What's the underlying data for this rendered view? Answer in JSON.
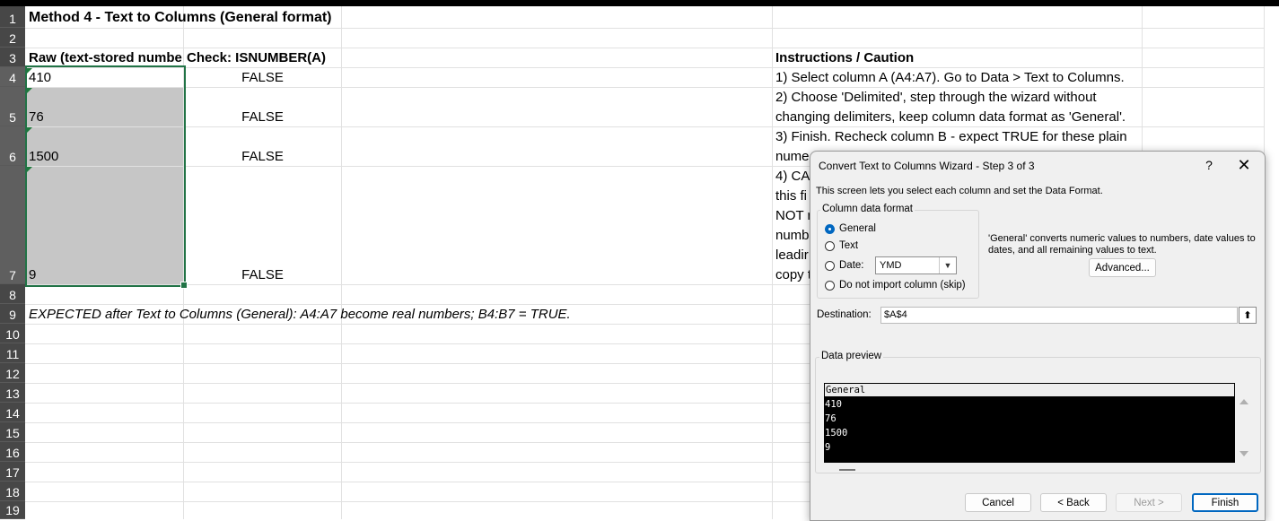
{
  "sheet": {
    "rows": [
      "1",
      "2",
      "3",
      "4",
      "5",
      "6",
      "7",
      "8",
      "9",
      "10",
      "11",
      "12",
      "13",
      "14",
      "15",
      "16",
      "17",
      "18",
      "19"
    ],
    "title": "Method 4 - Text to Columns (General format)",
    "header_a": "Raw (text-stored numbe",
    "header_b": "Check: ISNUMBER(A)",
    "header_instr": "Instructions / Caution",
    "a_values": [
      "410",
      "76",
      "1500",
      "9"
    ],
    "b_values": [
      "FALSE",
      "FALSE",
      "FALSE",
      "FALSE"
    ],
    "instr_1": "1) Select column A (A4:A7). Go to Data > Text to Columns.",
    "instr_2": "2) Choose 'Delimited', step through the wizard without changing delimiters, keep column data format as 'General'.",
    "instr_3": "3) Finish. Recheck column B - expect TRUE for these plain nume",
    "instr_4": "4) CA\nthis fi\nNOT r\nnumb\nleadir\ncopy t",
    "expected": "EXPECTED after Text to Columns (General): A4:A7 become real numbers; B4:B7 = TRUE."
  },
  "wizard": {
    "title": "Convert Text to Columns Wizard - Step 3 of 3",
    "help": "?",
    "close": "✕",
    "intro": "This screen lets you select each column and set the Data Format.",
    "format_group": "Column data format",
    "opt_general": "General",
    "opt_text": "Text",
    "opt_date": "Date:",
    "date_value": "YMD",
    "opt_skip": "Do not import column (skip)",
    "selected_option": "General",
    "description": "'General' converts numeric values to numbers, date values to dates, and all remaining values to text.",
    "advanced": "Advanced...",
    "destination_label": "Destination:",
    "destination_value": "$A$4",
    "preview_label": "Data preview",
    "preview_header": "General",
    "preview_rows": [
      "410",
      "76",
      "1500",
      "9"
    ],
    "cancel": "Cancel",
    "back": "< Back",
    "next": "Next >",
    "finish": "Finish"
  },
  "colors": {
    "selection_border": "#217346",
    "selection_fill": "#c6c6c6",
    "row_header": "#474747",
    "accent": "#0067c0"
  }
}
